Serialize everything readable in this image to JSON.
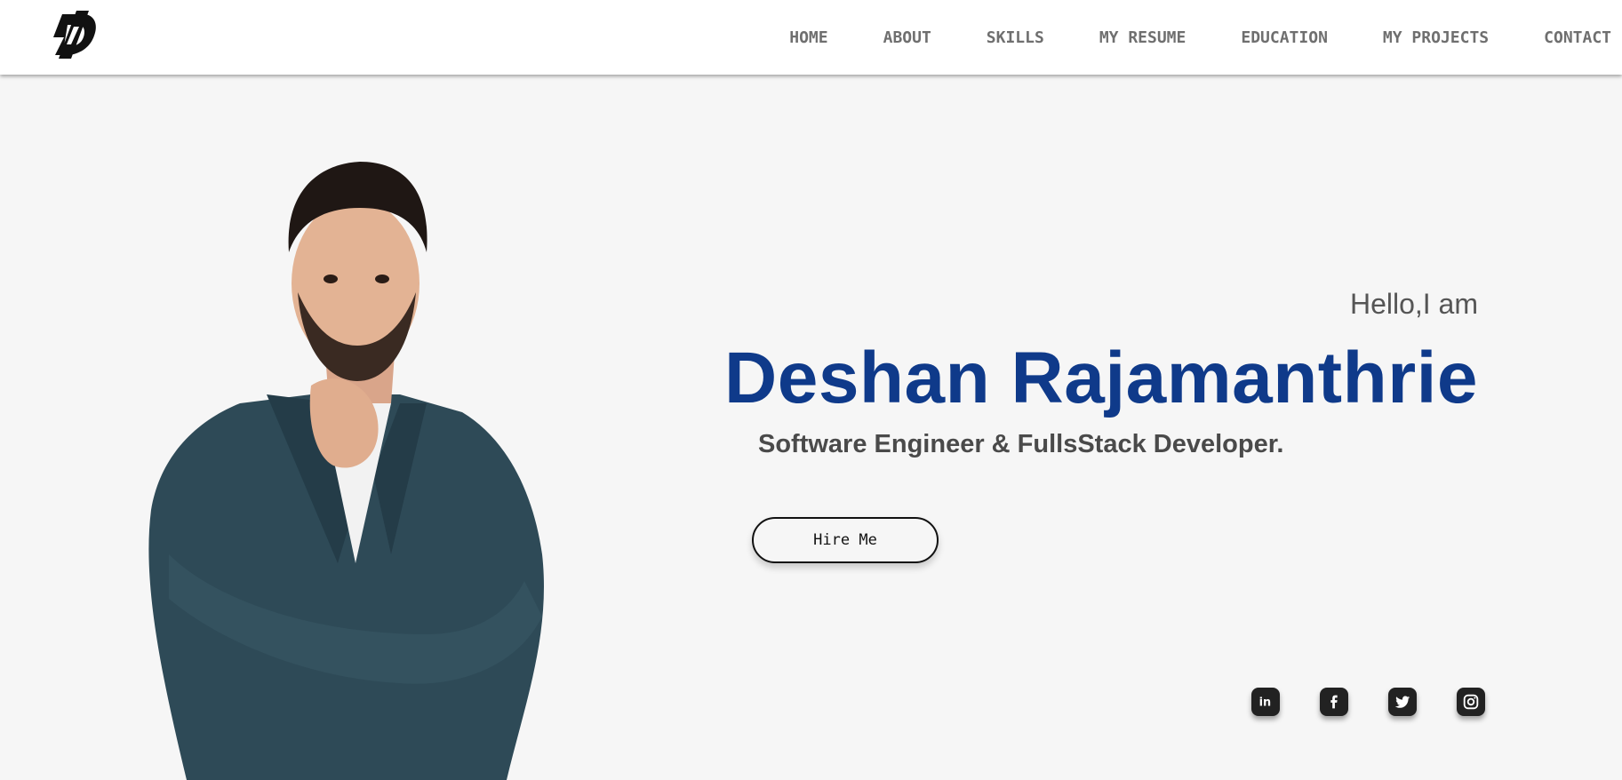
{
  "nav": {
    "logo_icon": "d-logo-icon",
    "items": [
      {
        "label": "HOME"
      },
      {
        "label": "ABOUT"
      },
      {
        "label": "SKILLS"
      },
      {
        "label": "MY RESUME"
      },
      {
        "label": "EDUCATION"
      },
      {
        "label": "MY PROJECTS"
      },
      {
        "label": "CONTACT"
      }
    ]
  },
  "hero": {
    "greeting": "Hello,I am",
    "name": "Deshan Rajamanthrie",
    "role": "Software Engineer & FullsStack Developer.",
    "hire_button": "Hire Me",
    "name_color": "#0f3a8a"
  },
  "socials": [
    {
      "icon": "linkedin-icon",
      "glyph": "in"
    },
    {
      "icon": "facebook-icon",
      "glyph": "f"
    },
    {
      "icon": "twitter-icon",
      "glyph": "twitter"
    },
    {
      "icon": "instagram-icon",
      "glyph": "instagram"
    }
  ]
}
